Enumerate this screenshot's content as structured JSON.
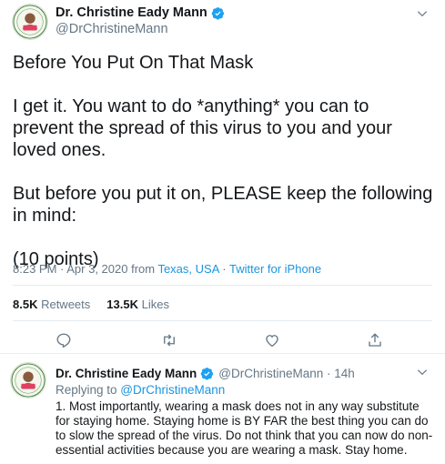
{
  "main_tweet": {
    "display_name": "Dr. Christine Eady Mann",
    "handle": "@DrChristineMann",
    "paragraphs": [
      "Before You Put On That Mask",
      "I get it. You want to do *anything* you can to prevent the spread of this virus to you and your loved ones.",
      "But before you put it on, PLEASE keep the following in mind:",
      "(10 points)"
    ],
    "time": "8:23 PM · Apr 3, 2020 from ",
    "location": "Texas, USA",
    "separator": " · ",
    "source": "Twitter for iPhone",
    "retweets_count": "8.5K",
    "retweets_label": " Retweets",
    "likes_count": "13.5K",
    "likes_label": " Likes"
  },
  "reply_tweet": {
    "display_name": "Dr. Christine Eady Mann",
    "handle_time": "@DrChristineMann · 14h",
    "replying_label": "Replying to ",
    "replying_handle": "@DrChristineMann",
    "text": "1. Most importantly, wearing a mask does not in any way substitute for staying home. Staying home is BY FAR the best thing you can do to slow the spread of the virus. Do not think that you can now do non-essential activities because you are wearing a mask. Stay home."
  },
  "icons": {
    "verified": "verified-badge-icon",
    "chevron": "chevron-down-icon",
    "reply": "reply-icon",
    "retweet": "retweet-icon",
    "like": "heart-icon",
    "share": "share-icon"
  },
  "colors": {
    "accent": "#1b95e0",
    "verified": "#1da1f2",
    "secondary_text": "#657786",
    "primary_text": "#14171a",
    "divider": "#e6ecf0"
  }
}
